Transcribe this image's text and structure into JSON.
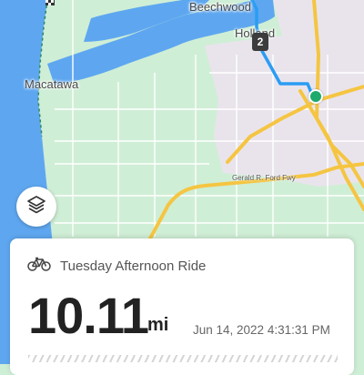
{
  "map": {
    "places": [
      "Beechwood",
      "Holland",
      "Macatawa"
    ],
    "road_label": "Gerald R. Ford Fwy",
    "lap_marker": "2"
  },
  "map_controls": {
    "layers_icon": "layers-icon"
  },
  "activity": {
    "type_icon": "bicycle-icon",
    "name": "Tuesday Afternoon Ride",
    "distance": "10.11",
    "distance_unit": "mi",
    "timestamp": "Jun 14, 2022 4:31:31 PM"
  },
  "colors": {
    "route": "#2a9df4",
    "end_marker": "#1fa96b",
    "water": "#5ea7f0",
    "park": "#cfeed6",
    "urban": "#e9e4ec",
    "highway": "#f5c542"
  }
}
